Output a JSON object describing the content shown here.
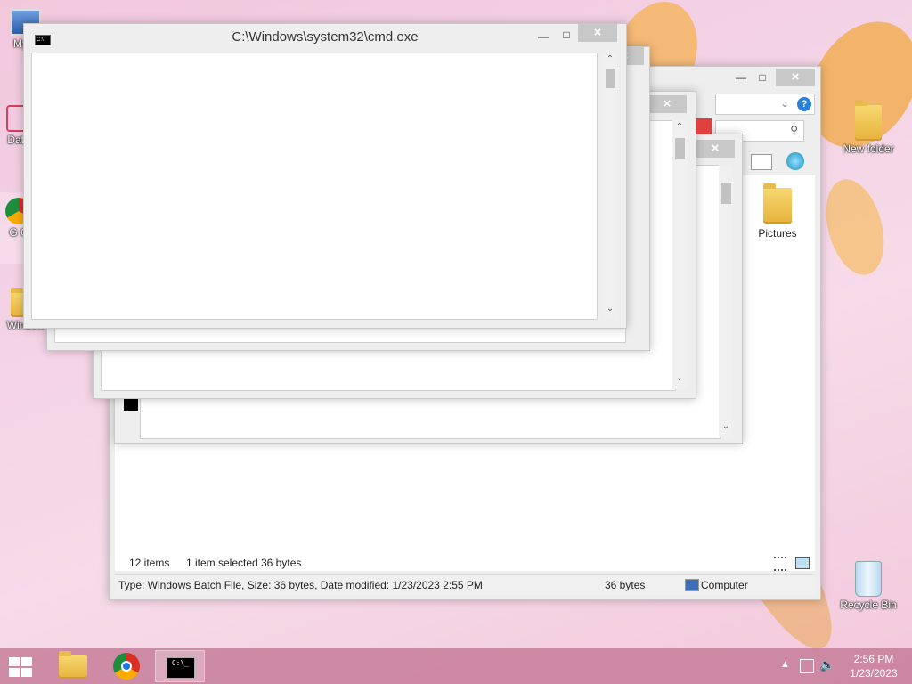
{
  "colors": {
    "desktop_bg": "#f3d0e3",
    "taskbar": "#c06e8c",
    "close_button": "#c8c8c8",
    "window_frame": "#eeeeee",
    "accent_red": "#e04040"
  },
  "desktop_icons": [
    {
      "label": "My C",
      "icon": "computer-icon"
    },
    {
      "label": "Data",
      "icon": "network-data-icon"
    },
    {
      "label": "G C",
      "icon": "chrome-icon"
    },
    {
      "label": "Window",
      "icon": "folder-icon"
    },
    {
      "label": "New folder",
      "icon": "folder-icon"
    },
    {
      "label": "Recycle Bin",
      "icon": "recycle-bin-icon"
    }
  ],
  "cmd_window": {
    "title": "C:\\Windows\\system32\\cmd.exe"
  },
  "explorer": {
    "pictures_label": "Pictures",
    "status_items_count": "12 items",
    "status_selected": "1 item selected",
    "status_size": "36 bytes",
    "details_info": "Type: Windows Batch File, Size: 36 bytes, Date modified: 1/23/2023 2:55 PM",
    "details_size": "36 bytes",
    "details_location": "Computer"
  },
  "tray": {
    "time": "2:56 PM",
    "date": "1/23/2023"
  }
}
